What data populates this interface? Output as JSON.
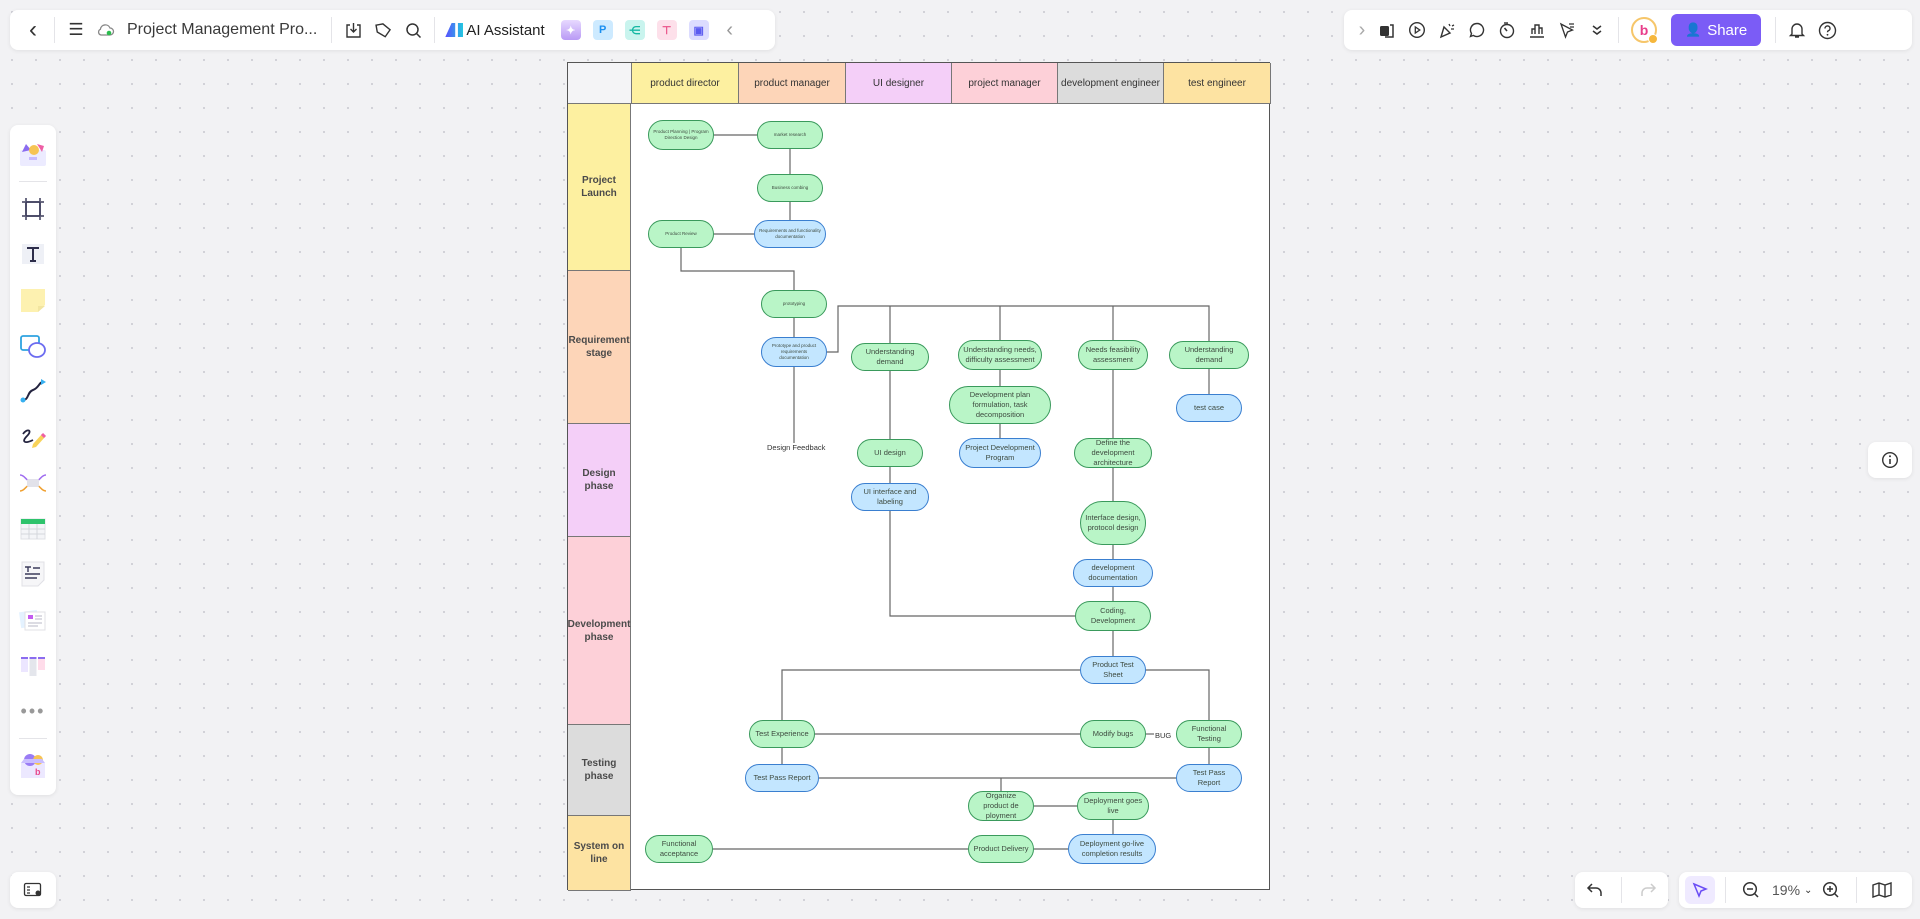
{
  "toolbar_left": {
    "back_label": "‹",
    "menu_icon": "☰",
    "title": "Project Management Pro...",
    "ai_label": "AI Assistant",
    "apps": [
      "image-gen",
      "P",
      "mindmap",
      "flowchart",
      "chat"
    ],
    "collapse": "‹"
  },
  "toolbar_right": {
    "expand": "›",
    "avatar_letter": "b",
    "share_label": "Share"
  },
  "zoom": {
    "level": "19%"
  },
  "swimlane": {
    "columns": [
      {
        "label": "product director",
        "color": "#fdf0a0"
      },
      {
        "label": "product manager",
        "color": "#fdd5b8"
      },
      {
        "label": "UI designer",
        "color": "#f4cff8"
      },
      {
        "label": "project manager",
        "color": "#fdd0d8"
      },
      {
        "label": "development engineer",
        "color": "#dcdcdc"
      },
      {
        "label": "test engineer",
        "color": "#fde3a2"
      }
    ],
    "rows": [
      {
        "label": "Project Launch",
        "color": "#fdf0a0"
      },
      {
        "label": "Requirement stage",
        "color": "#fdd5b8"
      },
      {
        "label": "Design phase",
        "color": "#f4cff8"
      },
      {
        "label": "Development phase",
        "color": "#fdd0d8"
      },
      {
        "label": "Testing phase",
        "color": "#dcdcdc"
      },
      {
        "label": "System on line",
        "color": "#fde3a2"
      }
    ],
    "nodes": {
      "n1": "Product Planning | Program Direction Design",
      "n2": "market research",
      "n3": "Business combing",
      "n4": "Product Review",
      "n5": "Requirements and functionality documentation",
      "n6": "prototyping",
      "n7": "Prototype and product requirements documentation",
      "n8": "Understanding demand",
      "n9": "Understanding needs, difficulty assessment",
      "n10": "Needs feasibility assessment",
      "n11": "Understanding demand",
      "n12": "Development plan formulation, task decomposition",
      "n13": "test case",
      "n14": "UI design",
      "n15": "Project Development Program",
      "n16": "Define the development architecture",
      "n17": "UI interface and labeling",
      "n18": "Interface design, protocol design",
      "n19": "development documentation",
      "n20": "Coding, Development",
      "n21": "Product Test Sheet",
      "n22": "Test Experience",
      "n23": "Modify bugs",
      "n24": "Functional Testing",
      "n25": "Test Pass Report",
      "n26": "Test Pass Report",
      "n27": "Organize product de ployment",
      "n28": "Deployment goes live",
      "n29": "Functional acceptance",
      "n30": "Product Delivery",
      "n31": "Deployment go-live completion results"
    },
    "labels": {
      "design_feedback": "Design Feedback",
      "bug": "BUG"
    }
  }
}
